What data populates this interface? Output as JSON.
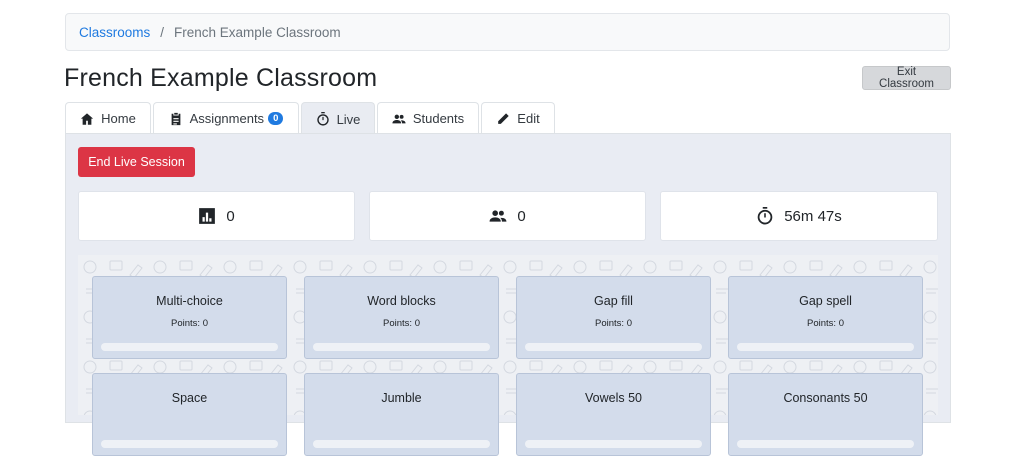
{
  "breadcrumb": {
    "link": "Classrooms",
    "separator": "/",
    "current": "French Example Classroom"
  },
  "page": {
    "title": "French Example Classroom",
    "exit_label": "Exit Classroom"
  },
  "tabs": [
    {
      "label": "Home",
      "icon": "home-icon"
    },
    {
      "label": "Assignments",
      "icon": "clipboard-icon",
      "badge": "0"
    },
    {
      "label": "Live",
      "icon": "stopwatch-icon",
      "active": true
    },
    {
      "label": "Students",
      "icon": "people-icon"
    },
    {
      "label": "Edit",
      "icon": "pencil-icon"
    }
  ],
  "live": {
    "end_label": "End Live Session",
    "stats": [
      {
        "icon": "bar-chart-icon",
        "value": "0"
      },
      {
        "icon": "people-icon",
        "value": "0"
      },
      {
        "icon": "stopwatch-icon",
        "value": "56m 47s"
      }
    ]
  },
  "activities": [
    {
      "title": "Multi-choice",
      "points": "Points: 0",
      "progress": 0
    },
    {
      "title": "Word blocks",
      "points": "Points: 0",
      "progress": 0
    },
    {
      "title": "Gap fill",
      "points": "Points: 0",
      "progress": 0
    },
    {
      "title": "Gap spell",
      "points": "Points: 0",
      "progress": 0
    },
    {
      "title": "Space",
      "points": "",
      "progress": 0
    },
    {
      "title": "Jumble",
      "points": "",
      "progress": 0
    },
    {
      "title": "Vowels 50",
      "points": "",
      "progress": 0
    },
    {
      "title": "Consonants 50",
      "points": "",
      "progress": 0
    }
  ],
  "colors": {
    "accent": "#1f7ae0",
    "danger": "#dc3545",
    "card": "#d3dceb",
    "panel": "#e9ecf3"
  }
}
